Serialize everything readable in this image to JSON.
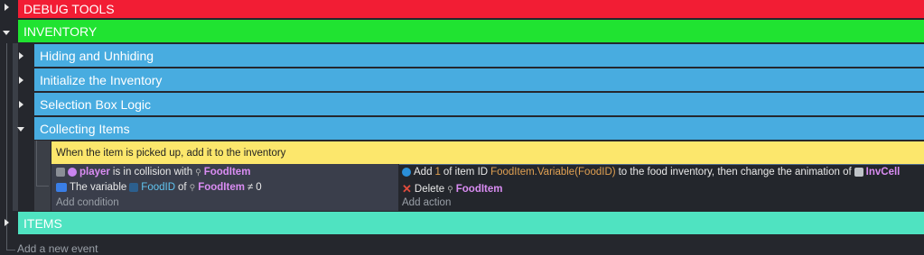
{
  "groups": [
    {
      "label": "DEBUG TOOLS",
      "color": "#f21d34"
    },
    {
      "label": "INVENTORY",
      "color": "#20e331"
    }
  ],
  "subgroups": [
    {
      "label": "Hiding and Unhiding",
      "color": "#48ace0"
    },
    {
      "label": "Initialize the Inventory",
      "color": "#48ace0"
    },
    {
      "label": "Selection Box Logic",
      "color": "#48ace0"
    },
    {
      "label": "Collecting Items",
      "color": "#48ace0"
    }
  ],
  "comment": {
    "text": "When the item is picked up, add it to the inventory",
    "color": "#fce76c"
  },
  "conditions": {
    "c1": {
      "object": "player",
      "text": "is in collision with",
      "target": "FoodItem"
    },
    "c2": {
      "prefix": "The variable",
      "variable": "FoodID",
      "of": "of",
      "object": "FoodItem",
      "operator": "≠",
      "value": "0"
    },
    "add_label": "Add condition"
  },
  "actions": {
    "a1": {
      "verb": "Add",
      "amount": "1",
      "mid": "of item ID",
      "expr": "FoodItem.Variable(FoodID)",
      "tail": "to the food inventory, then change the animation of",
      "object": "InvCell"
    },
    "a2": {
      "verb": "Delete",
      "object": "FoodItem"
    },
    "add_label": "Add action"
  },
  "items_group": {
    "label": "ITEMS",
    "color": "#4fe3c1"
  },
  "add_event": "Add a new event"
}
